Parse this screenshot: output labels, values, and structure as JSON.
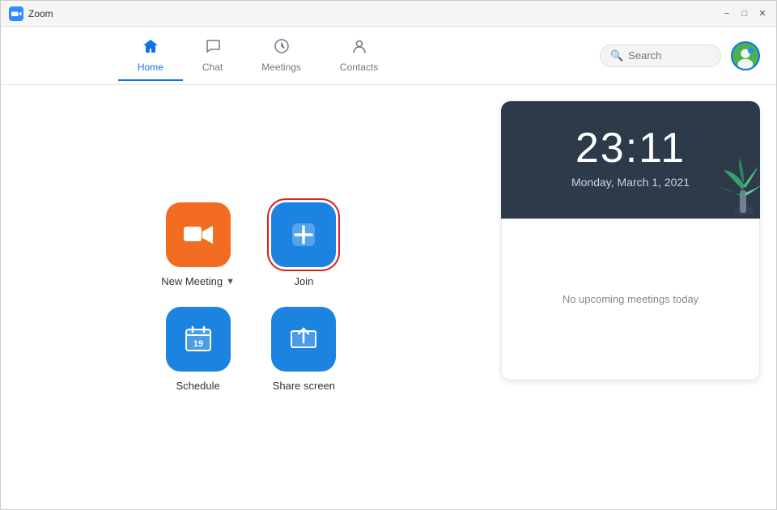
{
  "titleBar": {
    "appName": "Zoom",
    "minimizeLabel": "minimize",
    "maximizeLabel": "maximize",
    "closeLabel": "close"
  },
  "nav": {
    "tabs": [
      {
        "id": "home",
        "label": "Home",
        "icon": "🏠",
        "active": true
      },
      {
        "id": "chat",
        "label": "Chat",
        "icon": "💬",
        "active": false
      },
      {
        "id": "meetings",
        "label": "Meetings",
        "icon": "🕐",
        "active": false
      },
      {
        "id": "contacts",
        "label": "Contacts",
        "icon": "👤",
        "active": false
      }
    ],
    "search": {
      "placeholder": "Search"
    }
  },
  "settings": {
    "iconLabel": "⚙"
  },
  "actions": [
    {
      "id": "new-meeting",
      "label": "New Meeting",
      "hasDropdown": true,
      "colorClass": "orange",
      "icon": "🎥"
    },
    {
      "id": "join",
      "label": "Join",
      "hasDropdown": false,
      "colorClass": "blue-join",
      "icon": "+"
    },
    {
      "id": "schedule",
      "label": "Schedule",
      "hasDropdown": false,
      "colorClass": "blue",
      "icon": "📅"
    },
    {
      "id": "share-screen",
      "label": "Share screen",
      "hasDropdown": false,
      "colorClass": "blue",
      "icon": "↑"
    }
  ],
  "clock": {
    "time": "23:11",
    "date": "Monday, March 1, 2021"
  },
  "meetings": {
    "noMeetingsText": "No upcoming meetings today"
  }
}
